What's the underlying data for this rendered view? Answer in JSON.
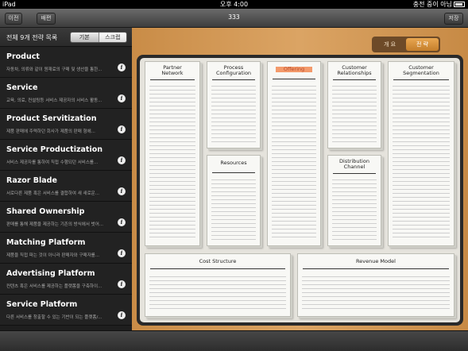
{
  "statusbar": {
    "device": "iPad",
    "time": "오후 4:00",
    "charge": "충전 중이 아님"
  },
  "navbar": {
    "left_button_1": "이전",
    "left_button_2": "배편",
    "title": "333",
    "right_button": "저장"
  },
  "sidebar": {
    "header": "전체 9개 전략 목록",
    "segments": [
      "기본",
      "스크랩"
    ],
    "items": [
      {
        "name": "Product",
        "desc": "자동차, 의류와 같이 원재료의 구매 및 생산을 통한..."
      },
      {
        "name": "Service",
        "desc": "교육, 의료, 컨설팅등 서비스 제공자의 서비스 활동..."
      },
      {
        "name": "Product Servitization",
        "desc": "제품 판매에 주력하던 회사가 제품의 판매 형에..."
      },
      {
        "name": "Service Productization",
        "desc": "서비스 제공자를 통하여 직접 수행되던 서비스를..."
      },
      {
        "name": "Razor Blade",
        "desc": "서로다른 제품 혹은 서비스를 결합하여 새 새로운..."
      },
      {
        "name": "Shared Ownership",
        "desc": "판매를 통해 제품을 제공하는 기존의 방식에서 벗어..."
      },
      {
        "name": "Matching Platform",
        "desc": "제품을 직접 파는 것이 아니라 판매자와 구매자를..."
      },
      {
        "name": "Advertising Platform",
        "desc": "컨텐츠 혹은 서비스를 제공하는 플랫폼을 구축하이..."
      },
      {
        "name": "Service Platform",
        "desc": "다른 서비스를 창출할 수 있는 기반이 되는 플랫폼/..."
      }
    ]
  },
  "tabs": [
    "개 요",
    "전 략"
  ],
  "canvas": {
    "partner_network": "Partner\nNetwork",
    "process_configuration": "Process\nConfiguration",
    "offering": "Offering",
    "customer_relationships": "Customer\nRelationships",
    "customer_segmentation": "Customer\nSegmentation",
    "resources": "Resources",
    "distribution_channel": "Distribution\nChannel",
    "cost_structure": "Cost Structure",
    "revenue_model": "Revenue Model"
  },
  "colors": {
    "offering_highlight": "#f39a6b",
    "tab_active": "#d8913a",
    "wood": "#d39b5a"
  }
}
